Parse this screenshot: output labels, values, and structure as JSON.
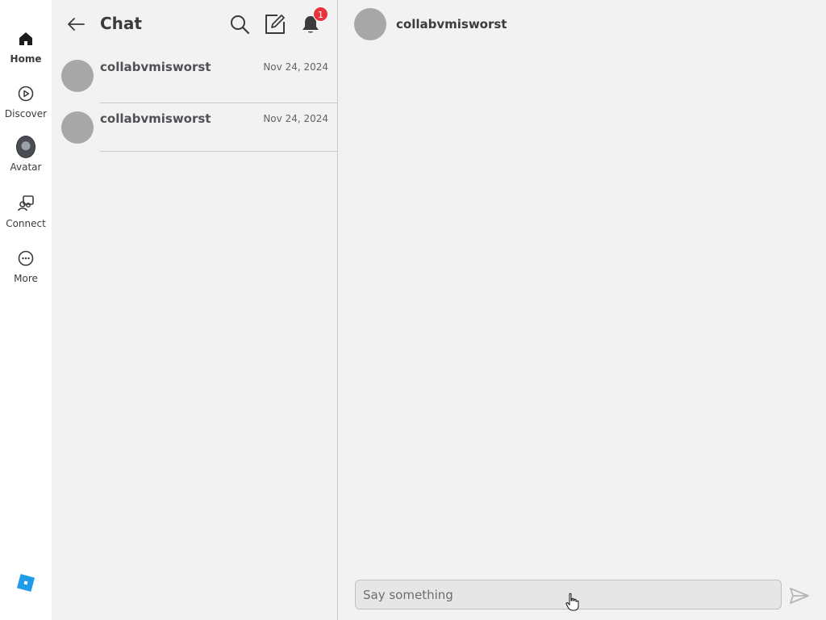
{
  "nav": {
    "items": [
      {
        "label": "Home",
        "icon": "home-icon",
        "active": true
      },
      {
        "label": "Discover",
        "icon": "play-circle-icon"
      },
      {
        "label": "Avatar",
        "icon": "avatar-icon"
      },
      {
        "label": "Connect",
        "icon": "connect-icon"
      },
      {
        "label": "More",
        "icon": "more-icon"
      }
    ],
    "logo_icon": "roblox-logo-icon"
  },
  "chat_list": {
    "title": "Chat",
    "notification_count": "1",
    "conversations": [
      {
        "name": "collabvmisworst",
        "date": "Nov 24, 2024"
      },
      {
        "name": "collabvmisworst",
        "date": "Nov 24, 2024"
      }
    ]
  },
  "conversation": {
    "name": "collabvmisworst",
    "input_placeholder": "Say something",
    "input_value": ""
  },
  "colors": {
    "badge": "#e8323c",
    "logo": "#1e9be9",
    "background": "#f2f2f3"
  }
}
